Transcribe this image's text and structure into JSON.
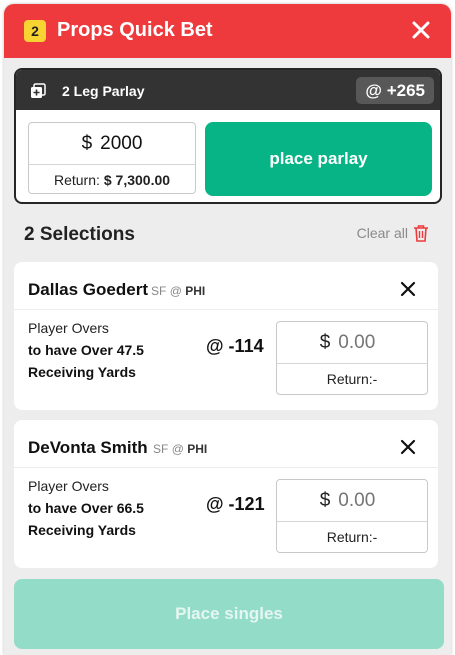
{
  "header": {
    "badge_count": "2",
    "title": "Props Quick Bet",
    "background_color": "#ee3a3d"
  },
  "parlay": {
    "label": "2 Leg Parlay",
    "odds": "@ +265",
    "currency": "$",
    "stake": "2000",
    "return_label": "Return:",
    "return_value": "$ 7,300.00",
    "place_label": "place parlay",
    "accent_color": "#06b486"
  },
  "selections_header": {
    "title": "2 Selections",
    "clear_label": "Clear all"
  },
  "selections": [
    {
      "player": "Dallas Goedert",
      "away": "SF",
      "at": "@",
      "home": "PHI",
      "market": "Player Overs",
      "line1": "to have Over 47.5",
      "line2": "Receiving Yards",
      "price": "@ -114",
      "currency": "$",
      "stake_placeholder": "0.00",
      "return_label": "Return:-"
    },
    {
      "player": "DeVonta Smith",
      "away": "SF",
      "at": "@",
      "home": "PHI",
      "market": "Player Overs",
      "line1": "to have Over 66.5",
      "line2": "Receiving Yards",
      "price": "@ -121",
      "currency": "$",
      "stake_placeholder": "0.00",
      "return_label": "Return:-"
    }
  ],
  "footer": {
    "place_singles_label": "Place singles",
    "disabled_color": "#92dcc8"
  },
  "icons": {
    "close": "close-icon",
    "parlay": "add-leg-icon",
    "trash": "trash-icon",
    "remove": "remove-selection-icon"
  }
}
